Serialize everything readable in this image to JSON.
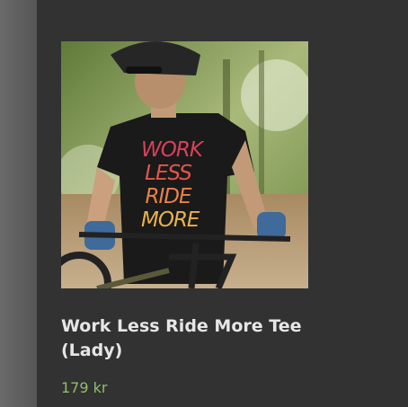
{
  "product": {
    "title": "Work Less Ride More Tee (Lady)",
    "price": "179 kr",
    "image_alt": "Rider on mountain bike wearing black tee",
    "shirt_print": [
      "WORK",
      "LESS",
      "RIDE",
      "MORE"
    ]
  },
  "colors": {
    "background": "#323232",
    "title": "#e6e6e6",
    "price": "#8fbf6a"
  }
}
